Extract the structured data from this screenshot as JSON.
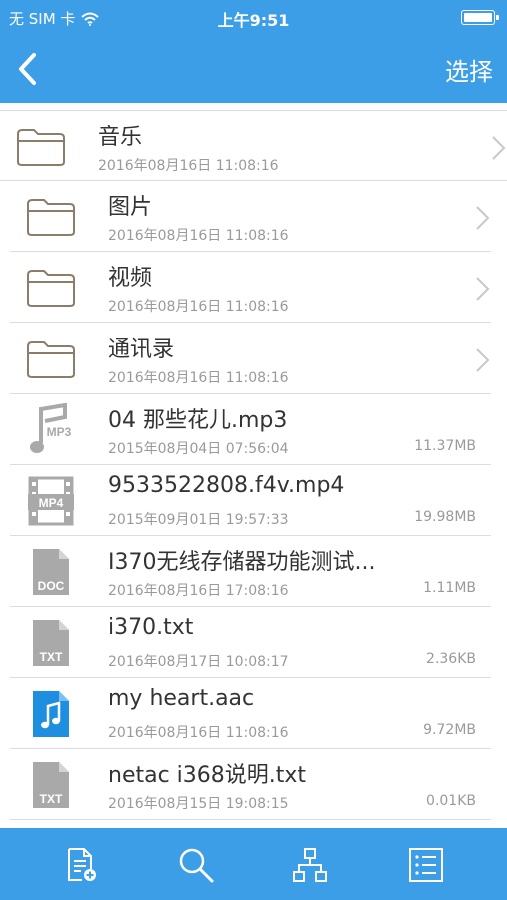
{
  "status_bar": {
    "carrier": "无 SIM 卡",
    "time": "上午9:51"
  },
  "nav": {
    "back_icon": "chevron-left-icon",
    "select_label": "选择"
  },
  "items": [
    {
      "kind": "folder",
      "name": "音乐",
      "date": "2016年08月16日 11:08:16",
      "size": ""
    },
    {
      "kind": "folder",
      "name": "图片",
      "date": "2016年08月16日 11:08:16",
      "size": ""
    },
    {
      "kind": "folder",
      "name": "视频",
      "date": "2016年08月16日 11:08:16",
      "size": ""
    },
    {
      "kind": "folder",
      "name": "通讯录",
      "date": "2016年08月16日 11:08:16",
      "size": ""
    },
    {
      "kind": "mp3",
      "name": "04 那些花儿.mp3",
      "date": "2015年08月04日 07:56:04",
      "size": "11.37MB",
      "badge": "MP3"
    },
    {
      "kind": "mp4",
      "name": "9533522808.f4v.mp4",
      "date": "2015年09月01日 19:57:33",
      "size": "19.98MB",
      "badge": "MP4"
    },
    {
      "kind": "doc",
      "name": "I370无线存储器功能测试...",
      "date": "2016年08月16日 17:08:16",
      "size": "1.11MB",
      "badge": "DOC"
    },
    {
      "kind": "txt",
      "name": "i370.txt",
      "date": "2016年08月17日 10:08:17",
      "size": "2.36KB",
      "badge": "TXT"
    },
    {
      "kind": "aac",
      "name": "my heart.aac",
      "date": "2016年08月16日 11:08:16",
      "size": "9.72MB"
    },
    {
      "kind": "txt",
      "name": "netac i368说明.txt",
      "date": "2016年08月15日 19:08:15",
      "size": "0.01KB",
      "badge": "TXT"
    }
  ],
  "toolbar": [
    {
      "icon": "new-document-icon"
    },
    {
      "icon": "search-icon"
    },
    {
      "icon": "hierarchy-icon"
    },
    {
      "icon": "list-icon"
    }
  ],
  "colors": {
    "accent": "#3d9ee8",
    "folder_stroke": "#8a7e6a",
    "file_gray": "#a9a9a9",
    "aac_blue": "#1e8fe0"
  }
}
